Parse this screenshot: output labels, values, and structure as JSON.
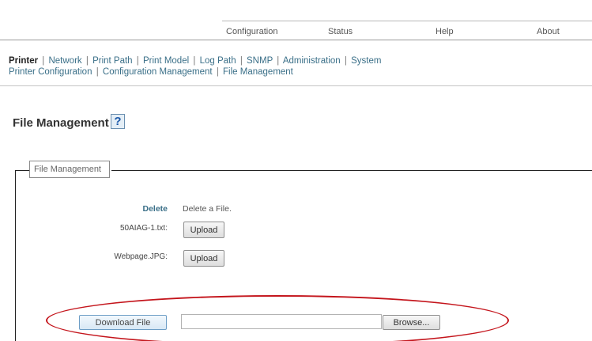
{
  "top_menu": {
    "configuration": "Configuration",
    "status": "Status",
    "help": "Help",
    "about": "About"
  },
  "nav": {
    "row1": [
      "Printer",
      "Network",
      "Print Path",
      "Print Model",
      "Log Path",
      "SNMP",
      "Administration",
      "System"
    ],
    "row2": [
      "Printer Configuration",
      "Configuration Management",
      "File Management"
    ],
    "separator": "|"
  },
  "page": {
    "title": "File Management",
    "help_icon_glyph": "?"
  },
  "fieldset": {
    "legend": "File Management",
    "delete": {
      "label": "Delete",
      "description": "Delete a File."
    },
    "files": [
      {
        "name": "50AIAG-1.txt:",
        "button": "Upload"
      },
      {
        "name": "Webpage.JPG:",
        "button": "Upload"
      }
    ],
    "download_button": "Download File",
    "file_input_value": "",
    "browse_button": "Browse..."
  },
  "colors": {
    "link": "#3a6f88",
    "annotation": "#c4151c",
    "help_icon": "#1a57a8"
  },
  "icons": [
    "help-icon"
  ]
}
